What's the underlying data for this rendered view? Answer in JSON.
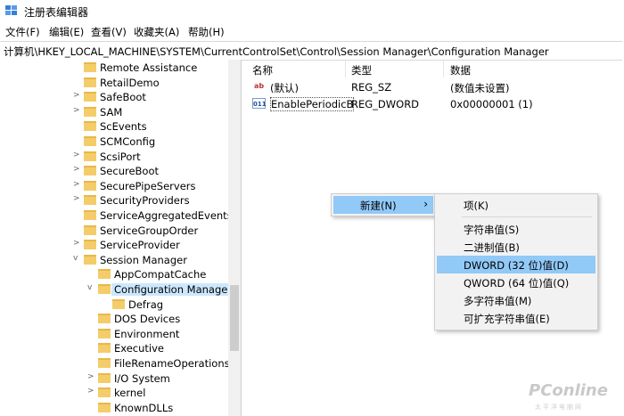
{
  "window": {
    "title": "注册表编辑器"
  },
  "menu": [
    "文件(F)",
    "编辑(E)",
    "查看(V)",
    "收藏夹(A)",
    "帮助(H)"
  ],
  "address": "计算机\\HKEY_LOCAL_MACHINE\\SYSTEM\\CurrentControlSet\\Control\\Session Manager\\Configuration Manager",
  "tree": [
    {
      "label": "Remote Assistance",
      "arrow": "",
      "level": 0
    },
    {
      "label": "RetailDemo",
      "arrow": "",
      "level": 0
    },
    {
      "label": "SafeBoot",
      "arrow": ">",
      "level": 0
    },
    {
      "label": "SAM",
      "arrow": ">",
      "level": 0
    },
    {
      "label": "ScEvents",
      "arrow": "",
      "level": 0
    },
    {
      "label": "SCMConfig",
      "arrow": "",
      "level": 0
    },
    {
      "label": "ScsiPort",
      "arrow": ">",
      "level": 0
    },
    {
      "label": "SecureBoot",
      "arrow": ">",
      "level": 0
    },
    {
      "label": "SecurePipeServers",
      "arrow": ">",
      "level": 0
    },
    {
      "label": "SecurityProviders",
      "arrow": ">",
      "level": 0
    },
    {
      "label": "ServiceAggregatedEvents",
      "arrow": "",
      "level": 0
    },
    {
      "label": "ServiceGroupOrder",
      "arrow": "",
      "level": 0
    },
    {
      "label": "ServiceProvider",
      "arrow": ">",
      "level": 0
    },
    {
      "label": "Session Manager",
      "arrow": "v",
      "level": 0
    },
    {
      "label": "AppCompatCache",
      "arrow": "",
      "level": 1
    },
    {
      "label": "Configuration Manager",
      "arrow": "v",
      "level": 1,
      "selected": true
    },
    {
      "label": "Defrag",
      "arrow": "",
      "level": 2
    },
    {
      "label": "DOS Devices",
      "arrow": "",
      "level": 1
    },
    {
      "label": "Environment",
      "arrow": "",
      "level": 1
    },
    {
      "label": "Executive",
      "arrow": "",
      "level": 1
    },
    {
      "label": "FileRenameOperations",
      "arrow": "",
      "level": 1
    },
    {
      "label": "I/O System",
      "arrow": ">",
      "level": 1
    },
    {
      "label": "kernel",
      "arrow": ">",
      "level": 1
    },
    {
      "label": "KnownDLLs",
      "arrow": "",
      "level": 1
    }
  ],
  "columns": {
    "name": "名称",
    "type": "类型",
    "data": "数据"
  },
  "values": [
    {
      "icon": "ab",
      "name": "(默认)",
      "type": "REG_SZ",
      "data": "(数值未设置)"
    },
    {
      "icon": "011",
      "name": "EnablePeriodicB...",
      "type": "REG_DWORD",
      "data": "0x00000001 (1)"
    }
  ],
  "context_menu": {
    "new_label": "新建(N)",
    "arrow": "›"
  },
  "submenu": {
    "key": "项(K)",
    "items": [
      "字符串值(S)",
      "二进制值(B)",
      "DWORD (32 位)值(D)",
      "QWORD (64 位)值(Q)",
      "多字符串值(M)",
      "可扩充字符串值(E)"
    ]
  },
  "watermark": {
    "text": "PConline",
    "sub": "太平洋电脑网"
  },
  "colors": {
    "highlight": "#91c9f7",
    "selected": "#cce8ff",
    "folder": "#f4cd6a"
  }
}
